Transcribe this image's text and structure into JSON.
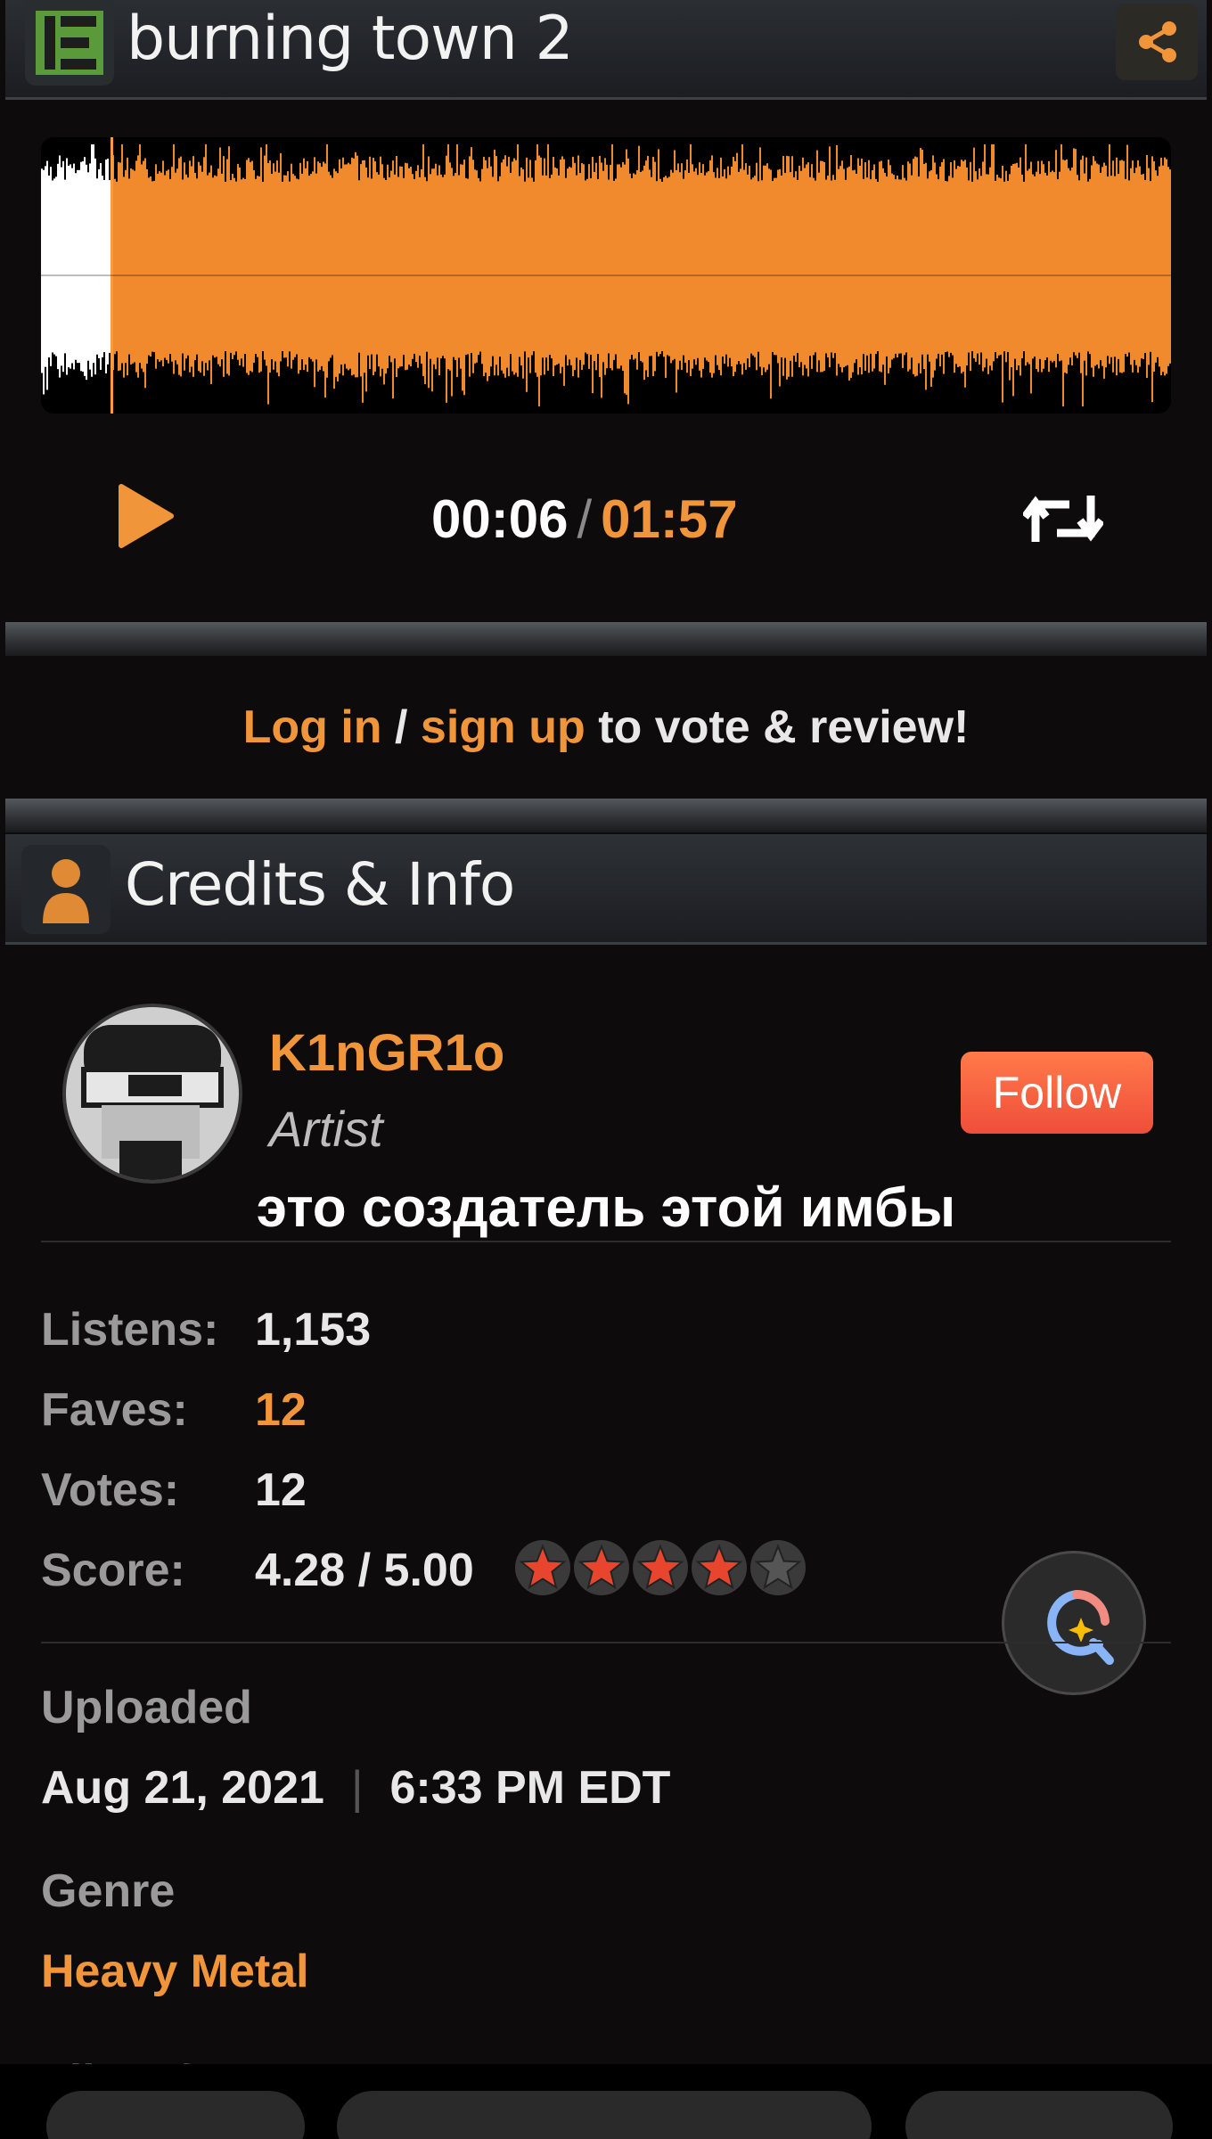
{
  "header": {
    "title": "burning town 2",
    "logo_icon": "newgrounds-logo-icon",
    "share_icon": "share-icon"
  },
  "player": {
    "elapsed": "00:06",
    "separator": "/",
    "total": "01:57",
    "progress_fraction": 0.06,
    "play_icon": "play-icon",
    "loop_icon": "loop-icon"
  },
  "login_prompt": {
    "login": "Log in",
    "sep": " / ",
    "signup": "sign up",
    "rest": " to vote & review!"
  },
  "credits": {
    "title": "Credits & Info",
    "artist_name": "K1nGR1o",
    "artist_role": "Artist",
    "follow_label": "Follow",
    "caption": "это создатель этой имбы"
  },
  "stats": {
    "listens_label": "Listens:",
    "listens": "1,153",
    "faves_label": "Faves:",
    "faves": "12",
    "votes_label": "Votes:",
    "votes": "12",
    "score_label": "Score:",
    "score": "4.28 / 5.00",
    "stars_filled": 4,
    "stars_total": 5
  },
  "meta": {
    "uploaded_label": "Uploaded",
    "uploaded_date": "Aug 21, 2021",
    "uploaded_sep": "|",
    "uploaded_time": "6:33 PM EDT",
    "genre_label": "Genre",
    "genre": "Heavy Metal",
    "file_info_label": "File Info"
  },
  "colors": {
    "accent": "#f0953a",
    "follow": "#f2553c",
    "background": "#0e0b0c"
  }
}
